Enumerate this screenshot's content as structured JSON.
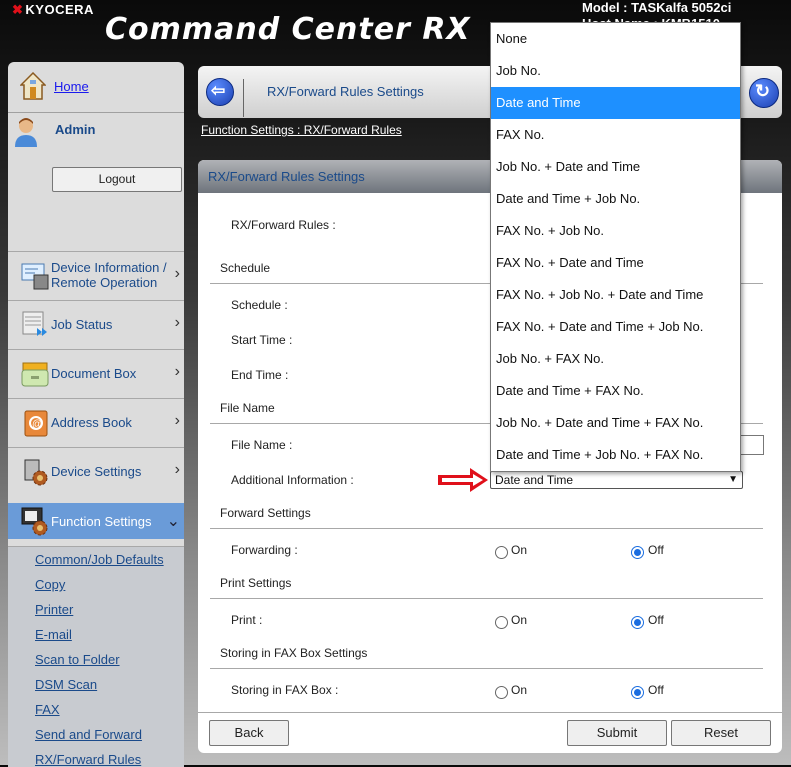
{
  "header": {
    "vendor": "KYOCERA",
    "product": "Command Center RX",
    "model": "Model : TASKalfa 5052ci",
    "host": "Host Name : KMB1510"
  },
  "sidebar": {
    "home": "Home",
    "user": "Admin",
    "logout": "Logout",
    "nav": [
      {
        "label1": "Device Information /",
        "label2": "Remote Operation",
        "icon": "device-info-icon"
      },
      {
        "label": "Job Status",
        "icon": "job-status-icon"
      },
      {
        "label": "Document Box",
        "icon": "document-box-icon"
      },
      {
        "label": "Address Book",
        "icon": "address-book-icon"
      },
      {
        "label": "Device Settings",
        "icon": "device-settings-icon"
      },
      {
        "label": "Function Settings",
        "icon": "function-settings-icon"
      }
    ],
    "submenu": [
      "Common/Job Defaults",
      "Copy",
      "Printer",
      "E-mail",
      "Scan to Folder",
      "DSM Scan",
      "FAX",
      "Send and Forward",
      "RX/Forward Rules"
    ]
  },
  "titlebar": {
    "title": "RX/Forward Rules Settings"
  },
  "breadcrumb": "Function Settings : RX/Forward Rules",
  "panel": {
    "title": "RX/Forward Rules Settings",
    "rx_rules_label": "RX/Forward Rules :",
    "schedule_section": "Schedule",
    "schedule_label": "Schedule :",
    "start_time_label": "Start Time :",
    "end_time_label": "End Time :",
    "file_name_section": "File Name",
    "file_name_label": "File Name :",
    "additional_info_label": "Additional Information :",
    "additional_info_value": "Date and Time",
    "forward_section": "Forward Settings",
    "forwarding_label": "Forwarding :",
    "print_section": "Print Settings",
    "print_label": "Print :",
    "fax_box_section": "Storing in FAX Box Settings",
    "fax_box_label": "Storing in FAX Box :",
    "on": "On",
    "off": "Off",
    "forwarding_value": "Off",
    "print_value": "Off",
    "fax_box_value": "Off",
    "back": "Back",
    "submit": "Submit",
    "reset": "Reset"
  },
  "dropdown": {
    "selected": "Date and Time",
    "options": [
      "None",
      "Job No.",
      "Date and Time",
      "FAX No.",
      "Job No. + Date and Time",
      "Date and Time + Job No.",
      "FAX No. + Job No.",
      "FAX No. + Date and Time",
      "FAX No. + Job No. + Date and Time",
      "FAX No. + Date and Time + Job No.",
      "Job No. + FAX No.",
      "Date and Time + FAX No.",
      "Job No. + Date and Time + FAX No.",
      "Date and Time + Job No. + FAX No."
    ]
  },
  "colors": {
    "accent": "#1e90ff",
    "nav_active": "#6a9bd8",
    "link": "#1a4a8a",
    "arrow": "#e0101a"
  }
}
